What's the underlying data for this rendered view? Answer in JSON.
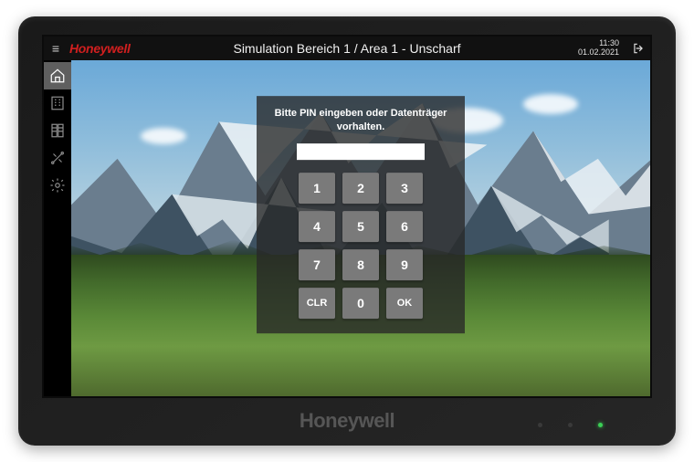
{
  "topbar": {
    "brand": "Honeywell",
    "title": "Simulation Bereich 1 / Area 1 - Unscharf",
    "time": "11:30",
    "date": "01.02.2021"
  },
  "sidenav": {
    "items": [
      {
        "name": "home",
        "active": true
      },
      {
        "name": "building",
        "active": false
      },
      {
        "name": "shutters",
        "active": false
      },
      {
        "name": "tools",
        "active": false
      },
      {
        "name": "settings",
        "active": false
      }
    ]
  },
  "pin": {
    "message_l1": "Bitte PIN eingeben oder Datenträger",
    "message_l2": "vorhalten.",
    "keys": [
      "1",
      "2",
      "3",
      "4",
      "5",
      "6",
      "7",
      "8",
      "9",
      "CLR",
      "0",
      "OK"
    ]
  },
  "bezel": {
    "brand": "Honeywell"
  }
}
